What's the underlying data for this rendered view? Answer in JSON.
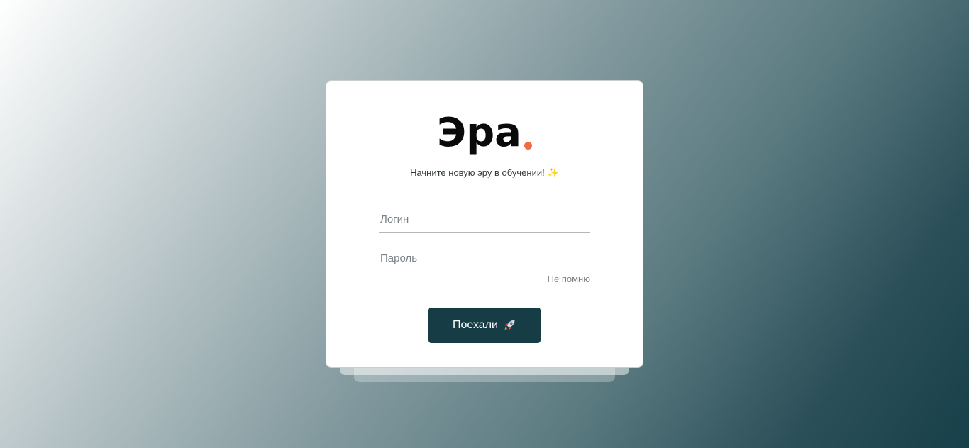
{
  "brand": {
    "logo_text": "Эра",
    "accent_color": "#ef6a45"
  },
  "tagline": {
    "text": "Начните новую эру в обучении!",
    "icon": "sparkles-icon"
  },
  "form": {
    "login_placeholder": "Логин",
    "login_value": "",
    "password_placeholder": "Пароль",
    "password_value": "",
    "forgot_label": "Не помню",
    "submit_label": "Поехали",
    "submit_icon": "rocket-icon",
    "submit_color": "#163c46"
  }
}
